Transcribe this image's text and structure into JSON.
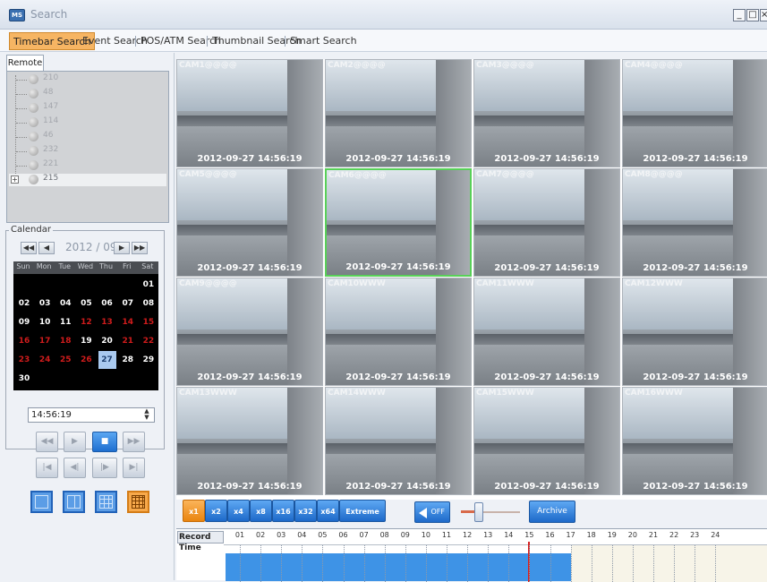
{
  "window": {
    "title": "Search",
    "icon_label": "MS",
    "controls": {
      "minimize": "_",
      "maximize": "□",
      "close": "×"
    }
  },
  "tabs": [
    {
      "label": "Timebar Search",
      "active": true
    },
    {
      "label": "Event Search",
      "active": false
    },
    {
      "label": "POS/ATM Search",
      "active": false
    },
    {
      "label": "Thumbnail Search",
      "active": false
    },
    {
      "label": "Smart Search",
      "active": false
    }
  ],
  "left_panel": {
    "tab_label": "Remote",
    "tree": [
      {
        "label": "210"
      },
      {
        "label": "48"
      },
      {
        "label": "147"
      },
      {
        "label": "114"
      },
      {
        "label": "46"
      },
      {
        "label": "232"
      },
      {
        "label": "221"
      },
      {
        "label": "215",
        "expander": "+",
        "selected": true
      }
    ],
    "calendar": {
      "legend": "Calendar",
      "month_label": "2012 / 09",
      "nav": {
        "prev_year": "◀◀",
        "prev_month": "◀",
        "next_month": "▶",
        "next_year": "▶▶"
      },
      "weekdays": [
        "Sun",
        "Mon",
        "Tue",
        "Wed",
        "Thu",
        "Fri",
        "Sat"
      ],
      "weeks": [
        [
          "",
          "",
          "",
          "",
          "",
          "",
          "01"
        ],
        [
          "02",
          "03",
          "04",
          "05",
          "06",
          "07",
          "08"
        ],
        [
          "09",
          "10",
          "11",
          "12",
          "13",
          "14",
          "15"
        ],
        [
          "16",
          "17",
          "18",
          "19",
          "20",
          "21",
          "22"
        ],
        [
          "23",
          "24",
          "25",
          "26",
          "27",
          "28",
          "29"
        ],
        [
          "30",
          "",
          "",
          "",
          "",
          "",
          ""
        ]
      ],
      "red_days": [
        "12",
        "13",
        "14",
        "15",
        "16",
        "17",
        "18",
        "21",
        "22",
        "23",
        "24",
        "25",
        "26"
      ],
      "selected_day": "27"
    },
    "time_value": "14:56:19",
    "time_spin": {
      "up": "▲",
      "down": "▼"
    },
    "playback_row1": [
      "◀◀",
      "▶",
      "■",
      "▶▶"
    ],
    "playback_row2": [
      "|◀",
      "◀|",
      "|▶",
      "▶|"
    ],
    "layouts": [
      "1x1",
      "2x2",
      "3x3",
      "4x4"
    ],
    "selected_layout": "4x4"
  },
  "cameras": [
    {
      "label": "CAM1@@@@",
      "timestamp": "2012-09-27 14:56:19"
    },
    {
      "label": "CAM2@@@@",
      "timestamp": "2012-09-27 14:56:19"
    },
    {
      "label": "CAM3@@@@",
      "timestamp": "2012-09-27 14:56:19"
    },
    {
      "label": "CAM4@@@@",
      "timestamp": "2012-09-27 14:56:19"
    },
    {
      "label": "CAM5@@@@",
      "timestamp": "2012-09-27 14:56:19"
    },
    {
      "label": "CAM6@@@@",
      "timestamp": "2012-09-27 14:56:19"
    },
    {
      "label": "CAM7@@@@",
      "timestamp": "2012-09-27 14:56:19"
    },
    {
      "label": "CAM8@@@@",
      "timestamp": "2012-09-27 14:56:19"
    },
    {
      "label": "CAM9@@@@",
      "timestamp": "2012-09-27 14:56:19"
    },
    {
      "label": "CAM10WWW",
      "timestamp": "2012-09-27 14:56:19"
    },
    {
      "label": "CAM11WWW",
      "timestamp": "2012-09-27 14:56:19"
    },
    {
      "label": "CAM12WWW",
      "timestamp": "2012-09-27 14:56:19"
    },
    {
      "label": "CAM13WWW",
      "timestamp": "2012-09-27 14:56:19"
    },
    {
      "label": "CAM14WWW",
      "timestamp": "2012-09-27 14:56:19"
    },
    {
      "label": "CAM15WWW",
      "timestamp": "2012-09-27 14:56:19"
    },
    {
      "label": "CAM16WWW",
      "timestamp": "2012-09-27 14:56:19"
    }
  ],
  "selected_camera": "CAM6@@@@",
  "playbar": {
    "speeds": [
      "x1",
      "x2",
      "x4",
      "x8",
      "x16",
      "x32",
      "x64",
      "Extreme"
    ],
    "selected_speed": "x1",
    "audio_label": "OFF",
    "volume_fraction": 0.5,
    "archive_label": "Archive"
  },
  "timeline": {
    "label": "Record Time",
    "hours": [
      "01",
      "02",
      "03",
      "04",
      "05",
      "06",
      "07",
      "08",
      "09",
      "10",
      "11",
      "12",
      "13",
      "14",
      "15",
      "16",
      "17",
      "18",
      "19",
      "20",
      "21",
      "22",
      "23",
      "24"
    ],
    "recorded_until_hour": 17,
    "cursor_hour": 15.0
  },
  "colors": {
    "accent_orange": "#f6b563",
    "accent_blue": "#3e93e6",
    "selected_border": "#58d058",
    "cursor_red": "#d52020",
    "holiday_red": "#d01c1c"
  }
}
